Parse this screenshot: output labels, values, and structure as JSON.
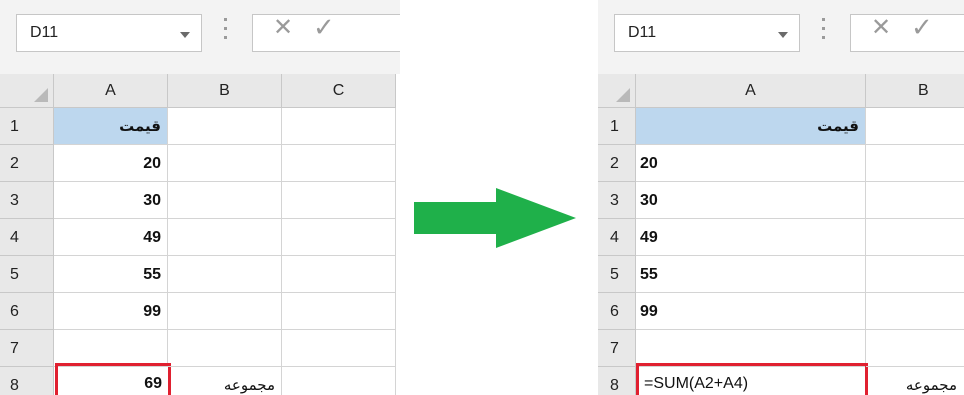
{
  "left": {
    "name_box": "D11",
    "columns": [
      "A",
      "B",
      "C"
    ],
    "rows": [
      "1",
      "2",
      "3",
      "4",
      "5",
      "6",
      "7",
      "8"
    ],
    "cells": {
      "a1": "قیمت",
      "a2": "20",
      "a3": "30",
      "a4": "49",
      "a5": "55",
      "a6": "99",
      "a8": "69",
      "b8": "مجموعه"
    }
  },
  "right": {
    "name_box": "D11",
    "columns": [
      "A",
      "B"
    ],
    "rows": [
      "1",
      "2",
      "3",
      "4",
      "5",
      "6",
      "7",
      "8"
    ],
    "cells": {
      "a1": "قیمت",
      "a2": "20",
      "a3": "30",
      "a4": "49",
      "a5": "55",
      "a6": "99",
      "a8": "=SUM(A2+A4)",
      "b8": "مجموعه"
    }
  },
  "colors": {
    "selection_border": "#e02030",
    "header_fill": "#bdd7ee",
    "arrow": "#1fb04a"
  },
  "icons": [
    "dropdown-icon",
    "cancel-icon",
    "enter-icon",
    "right-arrow-icon"
  ]
}
